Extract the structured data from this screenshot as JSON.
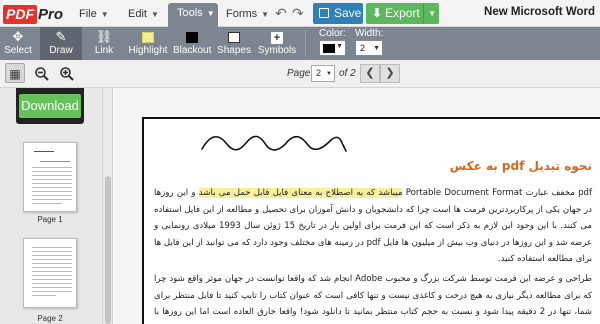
{
  "app": {
    "logo_pdf": "PDF",
    "logo_pro": "Pro",
    "document_title": "New Microsoft Word"
  },
  "menu": {
    "file": "File",
    "edit": "Edit",
    "tools": "Tools",
    "forms": "Forms"
  },
  "actions": {
    "save": "Save",
    "export": "Export"
  },
  "tools": {
    "select": "Select",
    "draw": "Draw",
    "link": "Link",
    "highlight": "Highlight",
    "blackout": "Blackout",
    "shapes": "Shapes",
    "symbols": "Symbols"
  },
  "options": {
    "color_label": "Color:",
    "color_value": "#000000",
    "width_label": "Width:",
    "width_value": "2"
  },
  "pager": {
    "label": "Page:",
    "current": "2",
    "of_text": "of 2"
  },
  "sidebar": {
    "download": "Download",
    "pages": [
      {
        "label": "Page 1"
      },
      {
        "label": "Page 2"
      }
    ]
  },
  "document": {
    "heading": "نحوه تبدیل pdf به عکس",
    "p1_before": "pdf مخفف عبارت Portable Document Format",
    "p1_highlight": "میباشد که به اصطلاح به معنای فایل قابل حمل می باشد",
    "p1_after": "و این روزها در جهان یکی از پرکاربردترین فرمت ها است چرا که دانشجویان و دانش آموزان برای تحصیل و مطالعه از این فایل استفاده می کنند. با این وجود این لازم به ذکر است که این فرمت برای اولین بار در تاریخ 15 ژوئن سال 1993 میلادی رونمایی و عرضه شد و این روزها در دنیای وب بیش از میلیون ها فایل pdf در زمینه های مختلف وجود دارد که می توانید از این فایل ها برای مطالعه استفاده کنید.",
    "p2": "طراحی و عرضه این فرمت توسط شرکت بزرگ و محبوب Adobe انجام شد که واقعا توانست در جهان موثر واقع شود چرا که برای مطالعه دیگر نیازی به هیچ درخت و کاغذی نیست و تنها کافی است که عنوان کتاب را تایپ کنید تا فایل منتظر برای شما، تنها در 2 دقیقه پیدا شود و نسبت به حجم کتاب منتظر بمانید تا دانلود شود! واقعا خارق العاده است اما این روزها با جستجویی"
  }
}
